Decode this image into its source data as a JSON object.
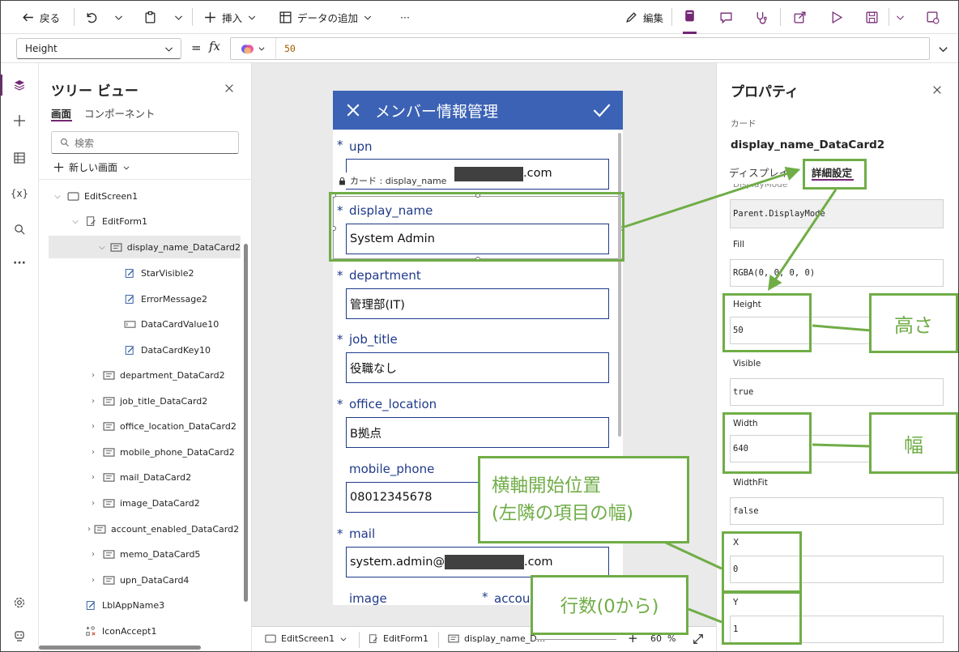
{
  "toolbar": {
    "back": "戻る",
    "insert": "挿入",
    "add_data": "データの追加",
    "more": "···",
    "edit": "編集"
  },
  "formula": {
    "property": "Height",
    "equals": "=",
    "fx": "fx",
    "value": "50"
  },
  "tree": {
    "title": "ツリー ビュー",
    "tab_screen": "画面",
    "tab_component": "コンポーネント",
    "search_placeholder": "検索",
    "new_screen": "新しい画面",
    "items": [
      {
        "label": "EditScreen1"
      },
      {
        "label": "EditForm1"
      },
      {
        "label": "display_name_DataCard2"
      },
      {
        "label": "StarVisible2"
      },
      {
        "label": "ErrorMessage2"
      },
      {
        "label": "DataCardValue10"
      },
      {
        "label": "DataCardKey10"
      },
      {
        "label": "department_DataCard2"
      },
      {
        "label": "job_title_DataCard2"
      },
      {
        "label": "office_location_DataCard2"
      },
      {
        "label": "mobile_phone_DataCard2"
      },
      {
        "label": "mail_DataCard2"
      },
      {
        "label": "image_DataCard2"
      },
      {
        "label": "account_enabled_DataCard2"
      },
      {
        "label": "memo_DataCard5"
      },
      {
        "label": "upn_DataCard4"
      },
      {
        "label": "LblAppName3"
      },
      {
        "label": "IconAccept1"
      }
    ]
  },
  "app": {
    "header_title": "メンバー情報管理",
    "lock_tooltip": "カード : display_name",
    "fields": {
      "upn_label": "upn",
      "upn_value": ".com",
      "display_name_label": "display_name",
      "display_name_value": "System Admin",
      "department_label": "department",
      "department_value": "管理部(IT)",
      "job_title_label": "job_title",
      "job_title_value": "役職なし",
      "office_location_label": "office_location",
      "office_location_value": "B拠点",
      "mobile_phone_label": "mobile_phone",
      "mobile_phone_value": "08012345678",
      "mail_label": "mail",
      "mail_value_start": "system.admin@",
      "mail_value_end": ".com",
      "image_label": "image",
      "account_label": "accou"
    }
  },
  "statusbar": {
    "screen": "EditScreen1",
    "form": "EditForm1",
    "card": "display_name_D...",
    "zoom": "60",
    "zoom_unit": "%"
  },
  "props": {
    "title": "プロパティ",
    "type": "カード",
    "name": "display_name_DataCard2",
    "tab_display": "ディスプレイ",
    "tab_advanced": "詳細設定",
    "cut_label": "DisplayMode",
    "rows": [
      {
        "label": "",
        "value": "Parent.DisplayMode"
      },
      {
        "label": "Fill",
        "value": "RGBA(0, 0, 0, 0)"
      },
      {
        "label": "Height",
        "value": "50"
      },
      {
        "label": "Visible",
        "value": "true"
      },
      {
        "label": "Width",
        "value": "640"
      },
      {
        "label": "WidthFit",
        "value": "false"
      },
      {
        "label": "X",
        "value": "0"
      },
      {
        "label": "Y",
        "value": "1"
      }
    ]
  },
  "annotations": {
    "height": "高さ",
    "width": "幅",
    "x_line1": "横軸開始位置",
    "x_line2": "(左隣の項目の幅)",
    "y": "行数(0から)",
    "color": "#70ad47"
  }
}
